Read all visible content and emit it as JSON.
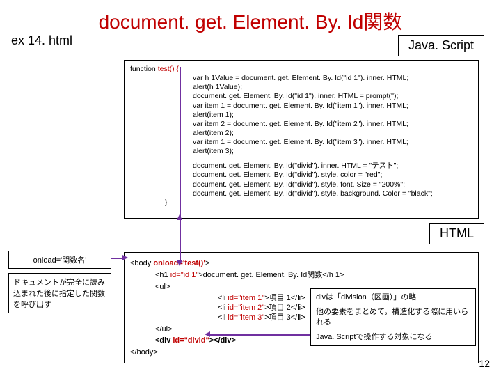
{
  "title": "document. get. Element. By. Id関数",
  "filename": "ex 14. html",
  "labels": {
    "javascript": "Java. Script",
    "html": "HTML"
  },
  "js": {
    "fn_open": "function",
    "fn_name": "test() {",
    "l1": "var h 1Value = document. get. Element. By. Id(\"id 1\"). inner. HTML;",
    "l2": "alert(h 1Value);",
    "l3": "document. get. Element. By. Id(\"id 1\"). inner. HTML = prompt('');",
    "l4": "var item 1 = document. get. Element. By. Id(\"item 1\"). inner. HTML;",
    "l5": "alert(item 1);",
    "l6": "var item 2 = document. get. Element. By. Id(\"item 2\"). inner. HTML;",
    "l7": "alert(item 2);",
    "l8": "var item 1 = document. get. Element. By. Id(\"item 3\"). inner. HTML;",
    "l9": "alert(item 3);",
    "l10": "document. get. Element. By. Id(\"divid\"). inner. HTML = \"テスト\";",
    "l11": "document. get. Element. By. Id(\"divid\"). style. color = \"red\";",
    "l12": "document. get. Element. By. Id(\"divid\"). style. font. Size = \"200%\";",
    "l13": "document. get. Element. By. Id(\"divid\"). style. background. Color = \"black\";",
    "close": "}"
  },
  "html": {
    "body_open_a": "<body ",
    "body_open_b": "onload='test()'",
    "body_open_c": ">",
    "h1_a": "<h1 ",
    "h1_b": "id=\"id 1\"",
    "h1_c": ">document. get. Element. By. Id関数</h 1>",
    "ul_open": "<ul>",
    "li1_a": "<li ",
    "li1_b": "id=\"item 1\"",
    "li1_c": ">項目 1</li>",
    "li2_a": "<li ",
    "li2_b": "id=\"item 2\"",
    "li2_c": ">項目 2</li>",
    "li3_a": "<li ",
    "li3_b": "id=\"item 3\"",
    "li3_c": ">項目 3</li>",
    "ul_close": "</ul>",
    "div_a": "<div ",
    "div_b": "id=\"divid\"",
    "div_c": "></div>",
    "body_close": "</body>"
  },
  "notes": {
    "onload": "onload='関数名'",
    "onload_desc": "ドキュメントが完全に読み込まれた後に指定した関数を呼び出す",
    "div_l1": "divは「division（区画）」の略",
    "div_l2": "他の要素をまとめて，構造化する際に用いられる",
    "div_l3": "Java. Scriptで操作する対象になる"
  },
  "page_num": "12"
}
